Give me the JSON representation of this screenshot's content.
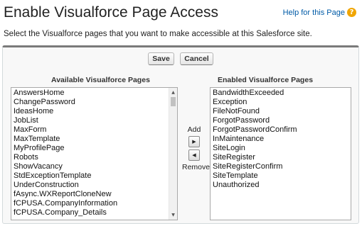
{
  "header": {
    "title": "Enable Visualforce Page Access",
    "help_link": "Help for this Page",
    "help_icon": "help-icon"
  },
  "description": "Select the Visualforce pages that you want to make accessible at this Salesforce site.",
  "toolbar": {
    "save_label": "Save",
    "cancel_label": "Cancel"
  },
  "available": {
    "label": "Available Visualforce Pages",
    "items": [
      "AnswersHome",
      "ChangePassword",
      "IdeasHome",
      "JobList",
      "MaxForm",
      "MaxTemplate",
      "MyProfilePage",
      "Robots",
      "ShowVacancy",
      "StdExceptionTemplate",
      "UnderConstruction",
      "fAsync.WXReportCloneNew",
      "fCPUSA.CompanyInformation",
      "fCPUSA.Company_Details"
    ]
  },
  "enabled": {
    "label": "Enabled Visualforce Pages",
    "items": [
      "BandwidthExceeded",
      "Exception",
      "FileNotFound",
      "ForgotPassword",
      "ForgotPasswordConfirm",
      "InMaintenance",
      "SiteLogin",
      "SiteRegister",
      "SiteRegisterConfirm",
      "SiteTemplate",
      "Unauthorized"
    ]
  },
  "mover": {
    "add_label": "Add",
    "remove_label": "Remove",
    "add_glyph": "▶",
    "remove_glyph": "◀"
  },
  "colors": {
    "link": "#015ba7",
    "help_icon_bg": "#f0a500",
    "panel_top_border": "#7a7a7a"
  }
}
